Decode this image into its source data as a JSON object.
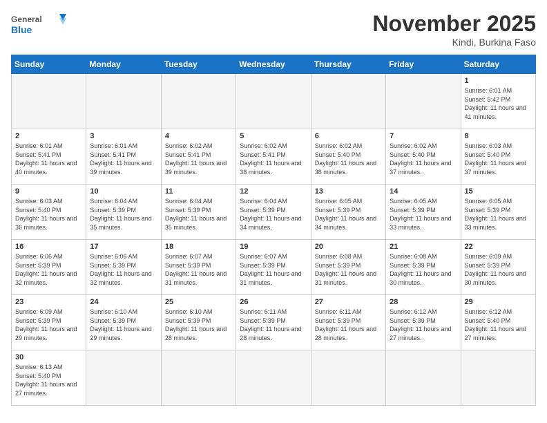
{
  "header": {
    "logo_general": "General",
    "logo_blue": "Blue",
    "month": "November 2025",
    "location": "Kindi, Burkina Faso"
  },
  "days_of_week": [
    "Sunday",
    "Monday",
    "Tuesday",
    "Wednesday",
    "Thursday",
    "Friday",
    "Saturday"
  ],
  "weeks": [
    [
      {
        "day": "",
        "empty": true
      },
      {
        "day": "",
        "empty": true
      },
      {
        "day": "",
        "empty": true
      },
      {
        "day": "",
        "empty": true
      },
      {
        "day": "",
        "empty": true
      },
      {
        "day": "",
        "empty": true
      },
      {
        "day": "1",
        "sunrise": "6:01 AM",
        "sunset": "5:42 PM",
        "daylight": "11 hours and 41 minutes."
      }
    ],
    [
      {
        "day": "2",
        "sunrise": "6:01 AM",
        "sunset": "5:41 PM",
        "daylight": "11 hours and 40 minutes."
      },
      {
        "day": "3",
        "sunrise": "6:01 AM",
        "sunset": "5:41 PM",
        "daylight": "11 hours and 39 minutes."
      },
      {
        "day": "4",
        "sunrise": "6:02 AM",
        "sunset": "5:41 PM",
        "daylight": "11 hours and 39 minutes."
      },
      {
        "day": "5",
        "sunrise": "6:02 AM",
        "sunset": "5:41 PM",
        "daylight": "11 hours and 38 minutes."
      },
      {
        "day": "6",
        "sunrise": "6:02 AM",
        "sunset": "5:40 PM",
        "daylight": "11 hours and 38 minutes."
      },
      {
        "day": "7",
        "sunrise": "6:02 AM",
        "sunset": "5:40 PM",
        "daylight": "11 hours and 37 minutes."
      },
      {
        "day": "8",
        "sunrise": "6:03 AM",
        "sunset": "5:40 PM",
        "daylight": "11 hours and 37 minutes."
      }
    ],
    [
      {
        "day": "9",
        "sunrise": "6:03 AM",
        "sunset": "5:40 PM",
        "daylight": "11 hours and 36 minutes."
      },
      {
        "day": "10",
        "sunrise": "6:04 AM",
        "sunset": "5:39 PM",
        "daylight": "11 hours and 35 minutes."
      },
      {
        "day": "11",
        "sunrise": "6:04 AM",
        "sunset": "5:39 PM",
        "daylight": "11 hours and 35 minutes."
      },
      {
        "day": "12",
        "sunrise": "6:04 AM",
        "sunset": "5:39 PM",
        "daylight": "11 hours and 34 minutes."
      },
      {
        "day": "13",
        "sunrise": "6:05 AM",
        "sunset": "5:39 PM",
        "daylight": "11 hours and 34 minutes."
      },
      {
        "day": "14",
        "sunrise": "6:05 AM",
        "sunset": "5:39 PM",
        "daylight": "11 hours and 33 minutes."
      },
      {
        "day": "15",
        "sunrise": "6:05 AM",
        "sunset": "5:39 PM",
        "daylight": "11 hours and 33 minutes."
      }
    ],
    [
      {
        "day": "16",
        "sunrise": "6:06 AM",
        "sunset": "5:39 PM",
        "daylight": "11 hours and 32 minutes."
      },
      {
        "day": "17",
        "sunrise": "6:06 AM",
        "sunset": "5:39 PM",
        "daylight": "11 hours and 32 minutes."
      },
      {
        "day": "18",
        "sunrise": "6:07 AM",
        "sunset": "5:39 PM",
        "daylight": "11 hours and 31 minutes."
      },
      {
        "day": "19",
        "sunrise": "6:07 AM",
        "sunset": "5:39 PM",
        "daylight": "11 hours and 31 minutes."
      },
      {
        "day": "20",
        "sunrise": "6:08 AM",
        "sunset": "5:39 PM",
        "daylight": "11 hours and 31 minutes."
      },
      {
        "day": "21",
        "sunrise": "6:08 AM",
        "sunset": "5:39 PM",
        "daylight": "11 hours and 30 minutes."
      },
      {
        "day": "22",
        "sunrise": "6:09 AM",
        "sunset": "5:39 PM",
        "daylight": "11 hours and 30 minutes."
      }
    ],
    [
      {
        "day": "23",
        "sunrise": "6:09 AM",
        "sunset": "5:39 PM",
        "daylight": "11 hours and 29 minutes."
      },
      {
        "day": "24",
        "sunrise": "6:10 AM",
        "sunset": "5:39 PM",
        "daylight": "11 hours and 29 minutes."
      },
      {
        "day": "25",
        "sunrise": "6:10 AM",
        "sunset": "5:39 PM",
        "daylight": "11 hours and 28 minutes."
      },
      {
        "day": "26",
        "sunrise": "6:11 AM",
        "sunset": "5:39 PM",
        "daylight": "11 hours and 28 minutes."
      },
      {
        "day": "27",
        "sunrise": "6:11 AM",
        "sunset": "5:39 PM",
        "daylight": "11 hours and 28 minutes."
      },
      {
        "day": "28",
        "sunrise": "6:12 AM",
        "sunset": "5:39 PM",
        "daylight": "11 hours and 27 minutes."
      },
      {
        "day": "29",
        "sunrise": "6:12 AM",
        "sunset": "5:40 PM",
        "daylight": "11 hours and 27 minutes."
      }
    ],
    [
      {
        "day": "30",
        "sunrise": "6:13 AM",
        "sunset": "5:40 PM",
        "daylight": "11 hours and 27 minutes."
      },
      {
        "day": "",
        "empty": true
      },
      {
        "day": "",
        "empty": true
      },
      {
        "day": "",
        "empty": true
      },
      {
        "day": "",
        "empty": true
      },
      {
        "day": "",
        "empty": true
      },
      {
        "day": "",
        "empty": true
      }
    ]
  ],
  "labels": {
    "sunrise": "Sunrise:",
    "sunset": "Sunset:",
    "daylight": "Daylight:"
  }
}
